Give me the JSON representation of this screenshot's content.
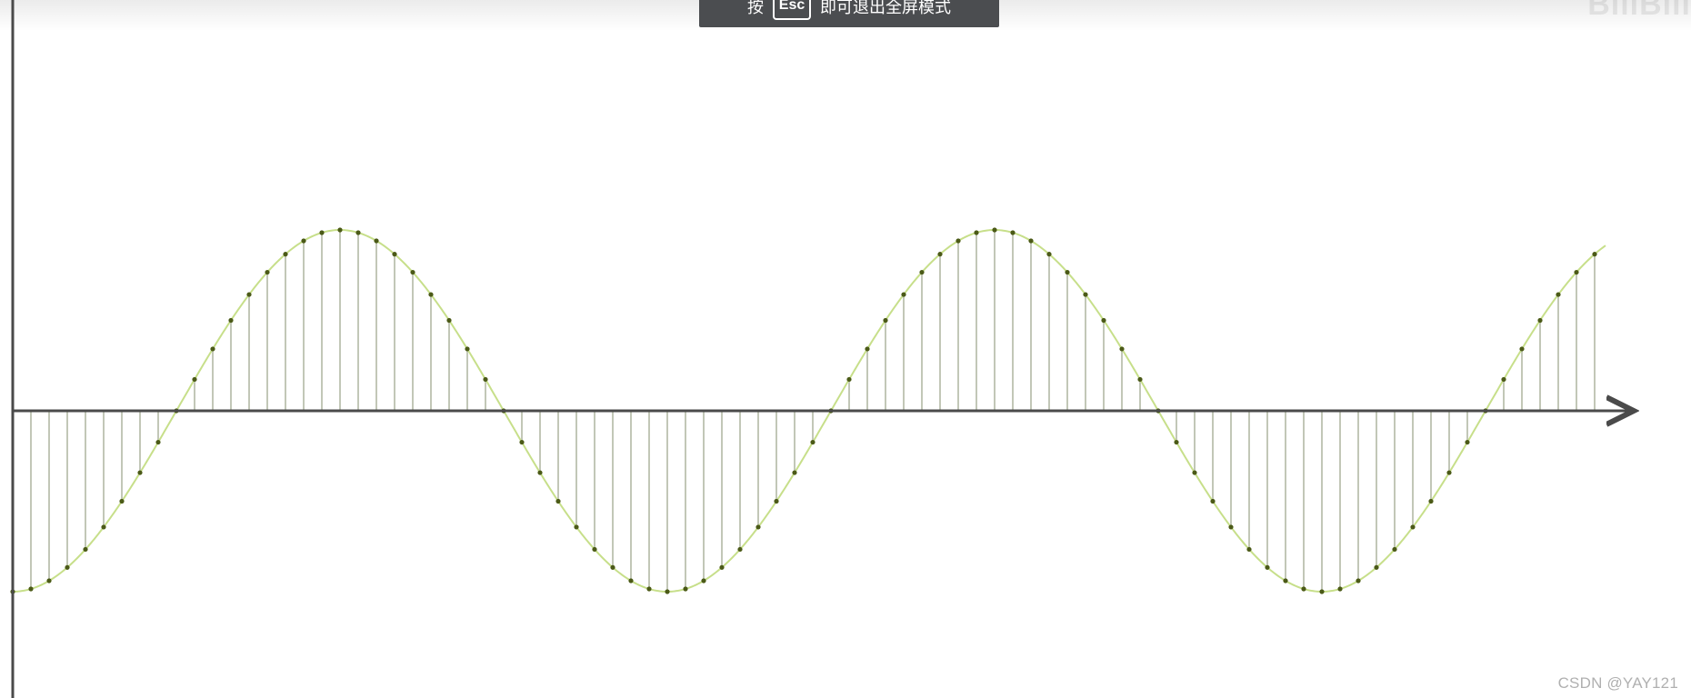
{
  "overlay": {
    "toast_before": "按",
    "esc_key": "Esc",
    "toast_after": "即可退出全屏模式",
    "watermark": "BiliBili"
  },
  "credit": "CSDN @YAY121",
  "colors": {
    "axis": "#4a4a4a",
    "curve": "#c7df8a",
    "stem": "#c2c7b7",
    "sample_dot": "#4b5a17"
  },
  "chart_data": {
    "type": "line",
    "subtype": "sampled-waveform",
    "title": "",
    "xlabel": "",
    "ylabel": "",
    "ylim": [
      -1,
      1
    ],
    "grid": false,
    "legend": "none",
    "curve": {
      "function": "sine",
      "amplitude": 1,
      "period_samples": 36,
      "phase_samples": -9
    },
    "samples": {
      "count": 88,
      "start_index": 0,
      "values_description": "y[n] = sin(2π(n-9)/36)"
    }
  }
}
